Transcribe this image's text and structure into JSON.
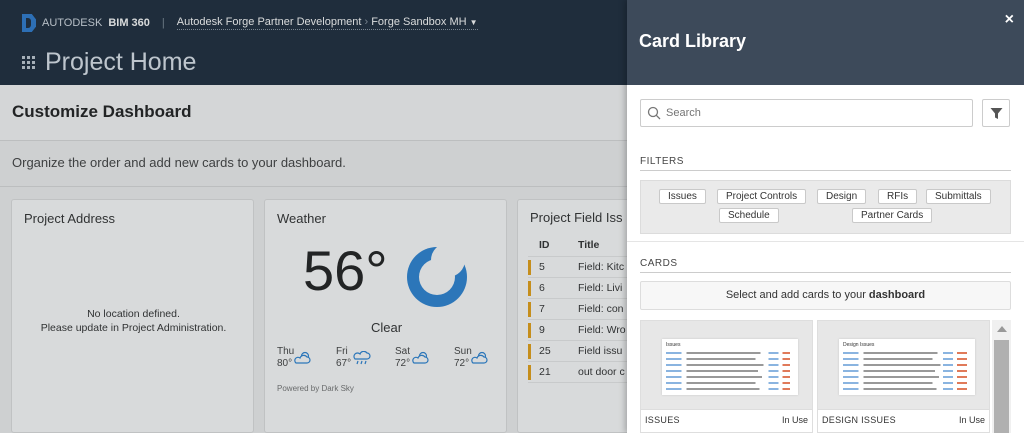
{
  "header": {
    "brand_company": "AUTODESK",
    "brand_product": "BIM 360",
    "account": "Autodesk Forge Partner Development",
    "project": "Forge Sandbox MH",
    "page_title": "Project Home"
  },
  "customize": {
    "title": "Customize Dashboard",
    "description": "Organize the order and add new cards to your dashboard."
  },
  "cards": {
    "address": {
      "title": "Project Address",
      "msg_line1": "No location defined.",
      "msg_line2": "Please update in Project Administration."
    },
    "weather": {
      "title": "Weather",
      "temperature": "56°",
      "condition": "Clear",
      "forecast": [
        {
          "day": "Thu",
          "temp": "80°",
          "icon": "partly-cloudy-icon"
        },
        {
          "day": "Fri",
          "temp": "67°",
          "icon": "rain-icon"
        },
        {
          "day": "Sat",
          "temp": "72°",
          "icon": "partly-cloudy-icon"
        },
        {
          "day": "Sun",
          "temp": "72°",
          "icon": "partly-cloudy-icon"
        }
      ],
      "powered_by": "Powered by Dark Sky"
    },
    "issues": {
      "title": "Project Field Iss",
      "col_id": "ID",
      "col_title": "Title",
      "rows": [
        {
          "id": "5",
          "title": "Field: Kitc"
        },
        {
          "id": "6",
          "title": "Field: Livi"
        },
        {
          "id": "7",
          "title": "Field: con"
        },
        {
          "id": "9",
          "title": "Field: Wro"
        },
        {
          "id": "25",
          "title": "Field issu"
        },
        {
          "id": "21",
          "title": "out door c"
        }
      ],
      "status_color": "#e8a317"
    }
  },
  "panel": {
    "title": "Card Library",
    "close_label": "×",
    "search_placeholder": "Search",
    "filters_label": "FILTERS",
    "filters": [
      "Issues",
      "Project Controls",
      "Design",
      "RFIs",
      "Submittals",
      "Schedule",
      "Partner Cards"
    ],
    "cards_label": "CARDS",
    "select_msg_prefix": "Select and add cards to your ",
    "select_msg_bold": "dashboard",
    "library_cards": [
      {
        "name": "ISSUES",
        "status": "In Use",
        "preview_title": "Issues"
      },
      {
        "name": "DESIGN ISSUES",
        "status": "In Use",
        "preview_title": "Design Issues"
      }
    ]
  },
  "colors": {
    "header_bg": "#1e2d3d",
    "panel_header_bg": "#3d4a5a",
    "accent_blue": "#2e86d6"
  }
}
